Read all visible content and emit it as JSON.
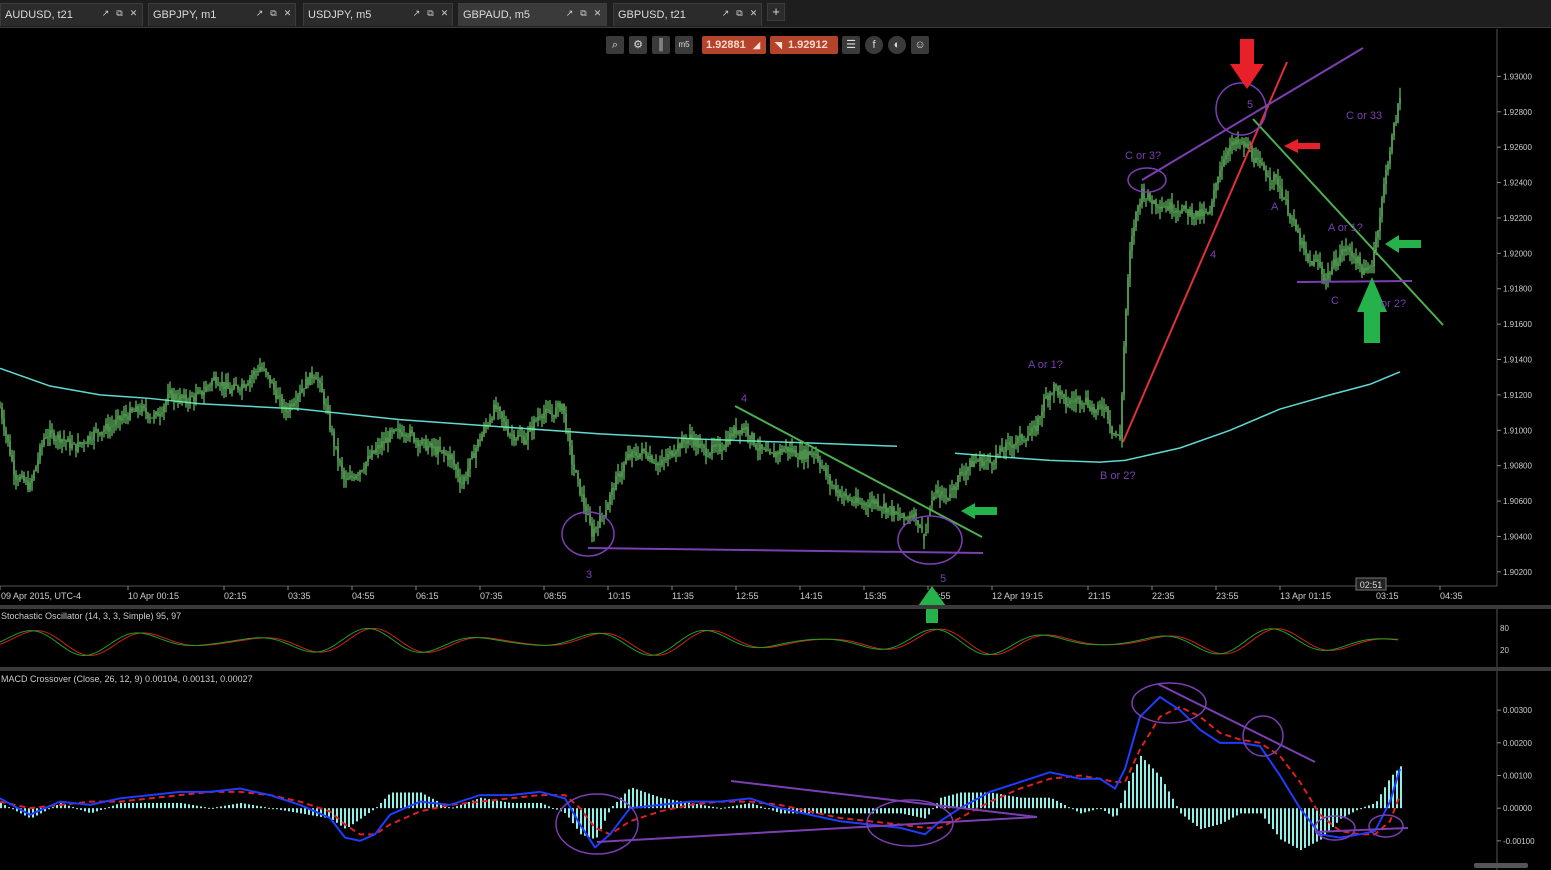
{
  "tabs": [
    {
      "label": "AUDUSD, t21",
      "active": false
    },
    {
      "label": "GBPJPY, m1",
      "active": false
    },
    {
      "label": "USDJPY, m5",
      "active": false
    },
    {
      "label": "GBPAUD, m5",
      "active": true
    },
    {
      "label": "GBPUSD, t21",
      "active": false
    }
  ],
  "add_tab_label": "+",
  "toolbar": {
    "timeframe_label": "m5",
    "sell_price": "1.92881",
    "buy_price": "1.92912",
    "icons": [
      "zoom-icon",
      "chart-type-icon",
      "candles-icon",
      "timeframe-icon",
      "list-icon",
      "facebook-icon",
      "share-icon",
      "trader-icon"
    ]
  },
  "chart_data": {
    "type": "line",
    "symbol": "GBPAUD",
    "timeframe": "m5",
    "price_axis_ticks": [
      "1.93000",
      "1.92800",
      "1.92600",
      "1.92400",
      "1.92200",
      "1.92000",
      "1.91800",
      "1.91600",
      "1.91400",
      "1.91200",
      "1.91000",
      "1.90800",
      "1.90600",
      "1.90400",
      "1.90200"
    ],
    "time_axis_ticks": [
      "09 Apr 2015, UTC-4",
      "10 Apr 00:15",
      "02:15",
      "03:35",
      "04:55",
      "06:15",
      "07:35",
      "08:55",
      "10:15",
      "11:35",
      "12:55",
      "14:15",
      "15:35",
      "17:55",
      "12 Apr 19:15",
      "21:15",
      "22:35",
      "23:55",
      "13 Apr 01:15",
      "03:15",
      "04:35"
    ],
    "current_time_label": "02:51",
    "ylim": [
      1.9012,
      1.932
    ],
    "price_series": [
      [
        0,
        1.9113
      ],
      [
        15,
        1.9075
      ],
      [
        30,
        1.9068
      ],
      [
        45,
        1.9098
      ],
      [
        60,
        1.9096
      ],
      [
        75,
        1.909
      ],
      [
        95,
        1.9099
      ],
      [
        110,
        1.9102
      ],
      [
        125,
        1.9108
      ],
      [
        140,
        1.9112
      ],
      [
        155,
        1.9107
      ],
      [
        170,
        1.912
      ],
      [
        185,
        1.9117
      ],
      [
        200,
        1.912
      ],
      [
        215,
        1.913
      ],
      [
        230,
        1.9122
      ],
      [
        245,
        1.9127
      ],
      [
        260,
        1.9136
      ],
      [
        270,
        1.9128
      ],
      [
        285,
        1.911
      ],
      [
        300,
        1.9123
      ],
      [
        315,
        1.9133
      ],
      [
        325,
        1.9115
      ],
      [
        335,
        1.909
      ],
      [
        345,
        1.907
      ],
      [
        360,
        1.9078
      ],
      [
        375,
        1.9088
      ],
      [
        390,
        1.9097
      ],
      [
        405,
        1.91
      ],
      [
        420,
        1.9093
      ],
      [
        435,
        1.9089
      ],
      [
        450,
        1.9085
      ],
      [
        462,
        1.907
      ],
      [
        478,
        1.9093
      ],
      [
        495,
        1.9113
      ],
      [
        510,
        1.9098
      ],
      [
        525,
        1.9095
      ],
      [
        540,
        1.911
      ],
      [
        552,
        1.9109
      ],
      [
        562,
        1.9115
      ],
      [
        572,
        1.9082
      ],
      [
        582,
        1.9062
      ],
      [
        592,
        1.9042
      ],
      [
        605,
        1.9055
      ],
      [
        615,
        1.907
      ],
      [
        628,
        1.9085
      ],
      [
        645,
        1.9088
      ],
      [
        660,
        1.908
      ],
      [
        675,
        1.909
      ],
      [
        690,
        1.9096
      ],
      [
        705,
        1.9088
      ],
      [
        720,
        1.909
      ],
      [
        735,
        1.91
      ],
      [
        745,
        1.9102
      ],
      [
        758,
        1.909
      ],
      [
        770,
        1.9085
      ],
      [
        785,
        1.909
      ],
      [
        800,
        1.9086
      ],
      [
        815,
        1.9088
      ],
      [
        830,
        1.907
      ],
      [
        845,
        1.9062
      ],
      [
        860,
        1.9058
      ],
      [
        875,
        1.906
      ],
      [
        890,
        1.9055
      ],
      [
        905,
        1.905
      ],
      [
        915,
        1.9053
      ],
      [
        925,
        1.904
      ],
      [
        935,
        1.9065
      ],
      [
        948,
        1.9062
      ],
      [
        960,
        1.9075
      ],
      [
        975,
        1.9083
      ],
      [
        990,
        1.9082
      ],
      [
        1005,
        1.909
      ],
      [
        1020,
        1.9095
      ],
      [
        1035,
        1.91
      ],
      [
        1045,
        1.9118
      ],
      [
        1055,
        1.9125
      ],
      [
        1065,
        1.9115
      ],
      [
        1075,
        1.9117
      ],
      [
        1085,
        1.9118
      ],
      [
        1095,
        1.911
      ],
      [
        1105,
        1.9115
      ],
      [
        1112,
        1.91
      ],
      [
        1120,
        1.9095
      ],
      [
        1125,
        1.916
      ],
      [
        1130,
        1.92
      ],
      [
        1135,
        1.922
      ],
      [
        1142,
        1.9235
      ],
      [
        1150,
        1.923
      ],
      [
        1165,
        1.9227
      ],
      [
        1180,
        1.9225
      ],
      [
        1195,
        1.9222
      ],
      [
        1210,
        1.9222
      ],
      [
        1218,
        1.9245
      ],
      [
        1228,
        1.926
      ],
      [
        1238,
        1.9262
      ],
      [
        1248,
        1.926
      ],
      [
        1258,
        1.925
      ],
      [
        1268,
        1.9245
      ],
      [
        1278,
        1.924
      ],
      [
        1288,
        1.9225
      ],
      [
        1298,
        1.921
      ],
      [
        1308,
        1.9195
      ],
      [
        1318,
        1.9195
      ],
      [
        1325,
        1.9185
      ],
      [
        1335,
        1.9195
      ],
      [
        1345,
        1.9203
      ],
      [
        1355,
        1.9198
      ],
      [
        1365,
        1.9188
      ],
      [
        1372,
        1.9195
      ],
      [
        1380,
        1.9222
      ],
      [
        1387,
        1.925
      ],
      [
        1393,
        1.9268
      ],
      [
        1400,
        1.9288
      ]
    ],
    "moving_average": [
      [
        0,
        1.9135
      ],
      [
        50,
        1.9125
      ],
      [
        100,
        1.912
      ],
      [
        150,
        1.9118
      ],
      [
        200,
        1.9115
      ],
      [
        300,
        1.9112
      ],
      [
        400,
        1.9106
      ],
      [
        500,
        1.9102
      ],
      [
        600,
        1.9098
      ],
      [
        700,
        1.9095
      ],
      [
        800,
        1.9093
      ],
      [
        897,
        1.9091
      ],
      [
        955,
        1.9087
      ],
      [
        1000,
        1.9085
      ],
      [
        1050,
        1.9083
      ],
      [
        1100,
        1.9082
      ],
      [
        1125,
        1.9083
      ],
      [
        1180,
        1.909
      ],
      [
        1230,
        1.91
      ],
      [
        1280,
        1.9112
      ],
      [
        1330,
        1.912
      ],
      [
        1370,
        1.9126
      ],
      [
        1400,
        1.9133
      ]
    ],
    "annotations": [
      "3",
      "4",
      "5",
      "A or 1?",
      "B or 2?",
      "C or 3?",
      "5",
      "4",
      "A",
      "A or 1?",
      "C",
      "or 2?",
      "C or 33"
    ],
    "stochastic": {
      "label": "Stochastic Oscillator (14, 3, 3, Simple) 95, 97",
      "ticks": [
        "80",
        "20"
      ]
    },
    "macd": {
      "label": "MACD Crossover (Close, 26, 12, 9) 0.00104, 0.00131, 0.00027",
      "ticks": [
        "0.00300",
        "0.00200",
        "0.00100",
        "0.00000",
        "-0.00100"
      ],
      "ylim": [
        -0.0018,
        0.0038
      ],
      "macd_series": [
        [
          0,
          0.0003
        ],
        [
          30,
          -0.0002
        ],
        [
          60,
          0.0002
        ],
        [
          90,
          0.0001
        ],
        [
          120,
          0.0003
        ],
        [
          150,
          0.0004
        ],
        [
          180,
          0.0005
        ],
        [
          210,
          0.0005
        ],
        [
          240,
          0.0006
        ],
        [
          270,
          0.0004
        ],
        [
          300,
          0.0001
        ],
        [
          330,
          -0.0003
        ],
        [
          345,
          -0.0009
        ],
        [
          360,
          -0.001
        ],
        [
          375,
          -0.0008
        ],
        [
          390,
          -0.0002
        ],
        [
          420,
          0.0002
        ],
        [
          450,
          0.0001
        ],
        [
          480,
          0.0004
        ],
        [
          510,
          0.0004
        ],
        [
          540,
          0.0005
        ],
        [
          565,
          0.0003
        ],
        [
          580,
          -0.0005
        ],
        [
          595,
          -0.0012
        ],
        [
          610,
          -0.0008
        ],
        [
          630,
          0.0
        ],
        [
          660,
          0.0001
        ],
        [
          690,
          0.0002
        ],
        [
          720,
          0.0002
        ],
        [
          750,
          0.0003
        ],
        [
          780,
          0.0
        ],
        [
          810,
          -0.0002
        ],
        [
          840,
          -0.0004
        ],
        [
          870,
          -0.0005
        ],
        [
          900,
          -0.0006
        ],
        [
          925,
          -0.0008
        ],
        [
          940,
          -0.0004
        ],
        [
          960,
          0.0
        ],
        [
          990,
          0.0005
        ],
        [
          1020,
          0.0008
        ],
        [
          1050,
          0.0011
        ],
        [
          1080,
          0.0009
        ],
        [
          1100,
          0.0009
        ],
        [
          1115,
          0.0006
        ],
        [
          1125,
          0.0012
        ],
        [
          1140,
          0.0028
        ],
        [
          1160,
          0.0034
        ],
        [
          1180,
          0.003
        ],
        [
          1200,
          0.0024
        ],
        [
          1220,
          0.002
        ],
        [
          1240,
          0.002
        ],
        [
          1260,
          0.0019
        ],
        [
          1280,
          0.001
        ],
        [
          1300,
          0.0
        ],
        [
          1320,
          -0.0008
        ],
        [
          1340,
          -0.0009
        ],
        [
          1360,
          -0.0008
        ],
        [
          1375,
          -0.0007
        ],
        [
          1390,
          0.0002
        ],
        [
          1400,
          0.0012
        ]
      ],
      "signal_series": [
        [
          0,
          0.0002
        ],
        [
          30,
          0.0
        ],
        [
          60,
          0.0001
        ],
        [
          90,
          0.0002
        ],
        [
          120,
          0.0002
        ],
        [
          150,
          0.0003
        ],
        [
          180,
          0.0004
        ],
        [
          210,
          0.0005
        ],
        [
          240,
          0.0005
        ],
        [
          270,
          0.0004
        ],
        [
          300,
          0.0002
        ],
        [
          330,
          -0.0001
        ],
        [
          345,
          -0.0005
        ],
        [
          360,
          -0.0008
        ],
        [
          375,
          -0.0008
        ],
        [
          390,
          -0.0005
        ],
        [
          420,
          -0.0001
        ],
        [
          450,
          0.0001
        ],
        [
          480,
          0.0002
        ],
        [
          510,
          0.0003
        ],
        [
          540,
          0.0004
        ],
        [
          565,
          0.0004
        ],
        [
          580,
          0.0
        ],
        [
          595,
          -0.0006
        ],
        [
          610,
          -0.0008
        ],
        [
          630,
          -0.0004
        ],
        [
          660,
          -0.0001
        ],
        [
          690,
          0.0001
        ],
        [
          720,
          0.0002
        ],
        [
          750,
          0.0002
        ],
        [
          780,
          0.0001
        ],
        [
          810,
          -0.0001
        ],
        [
          840,
          -0.0003
        ],
        [
          870,
          -0.0004
        ],
        [
          900,
          -0.0005
        ],
        [
          925,
          -0.0006
        ],
        [
          940,
          -0.0006
        ],
        [
          960,
          -0.0003
        ],
        [
          990,
          0.0002
        ],
        [
          1020,
          0.0006
        ],
        [
          1050,
          0.0009
        ],
        [
          1080,
          0.001
        ],
        [
          1100,
          0.0009
        ],
        [
          1115,
          0.0008
        ],
        [
          1125,
          0.0008
        ],
        [
          1140,
          0.0018
        ],
        [
          1160,
          0.0028
        ],
        [
          1180,
          0.0031
        ],
        [
          1200,
          0.0028
        ],
        [
          1220,
          0.0023
        ],
        [
          1240,
          0.0021
        ],
        [
          1260,
          0.002
        ],
        [
          1280,
          0.0016
        ],
        [
          1300,
          0.0008
        ],
        [
          1320,
          -0.0002
        ],
        [
          1340,
          -0.0007
        ],
        [
          1360,
          -0.0008
        ],
        [
          1375,
          -0.0008
        ],
        [
          1390,
          -0.0004
        ],
        [
          1400,
          0.0004
        ]
      ]
    }
  },
  "colors": {
    "background": "#000000",
    "candles": "#7ef07e",
    "moving_average": "#5fd9d2",
    "annotation_purple": "#7b3fb3",
    "trendline_green": "#4caf50",
    "trendline_red": "#e0303a",
    "arrow_green": "#25b24a",
    "arrow_red": "#e8202a",
    "macd_line": "#1f3cff",
    "signal_line": "#e02020",
    "histogram": "#8ff0e8",
    "stoch_k": "#20a020",
    "stoch_d": "#d02020",
    "price_button": "#b3442b"
  }
}
